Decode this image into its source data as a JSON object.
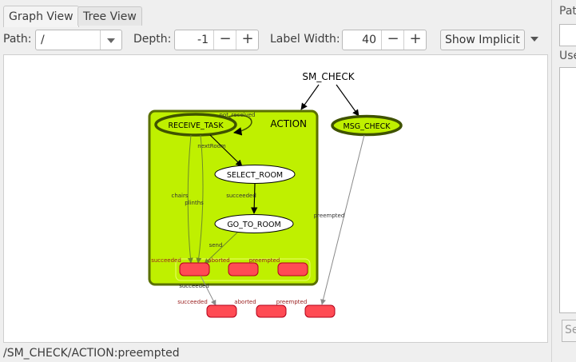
{
  "tabs": [
    {
      "label": "Graph View"
    },
    {
      "label": "Tree View"
    }
  ],
  "toolbar": {
    "path_label": "Path:",
    "path_value": "/",
    "depth_label": "Depth:",
    "depth_value": "-1",
    "label_width_label": "Label Width:",
    "label_width_value": "40",
    "minus": "−",
    "plus": "+",
    "show_implicit_label": "Show Implicit"
  },
  "graph": {
    "root": "SM_CHECK",
    "container": "ACTION",
    "states": {
      "receive_task": "RECEIVE_TASK",
      "select_room": "SELECT_ROOM",
      "go_to_room": "GO_TO_ROOM",
      "msg_check": "MSG_CHECK"
    },
    "edges": {
      "not_received": "not_received",
      "next_room": "nextRoom",
      "chairs": "chairs",
      "plinths": "plinths",
      "succeeded": "succeeded",
      "send": "send",
      "preempted": "preempted",
      "aborted": "aborted"
    },
    "outcomes_inner": [
      "succeeded",
      "aborted",
      "preempted"
    ],
    "outcomes_outer": [
      "succeeded",
      "aborted",
      "preempted"
    ],
    "colors": {
      "container_fill": "#bff000",
      "container_border": "#5a7000",
      "state_active": "#bff000",
      "outcome_fill": "#ff4b54",
      "outcome_border": "#b0001a",
      "outcome_label": "#9b2020"
    }
  },
  "status": "/SM_CHECK/ACTION:preempted",
  "right_panel": {
    "label1": "Pat",
    "label2": "Use",
    "button": "Se"
  }
}
